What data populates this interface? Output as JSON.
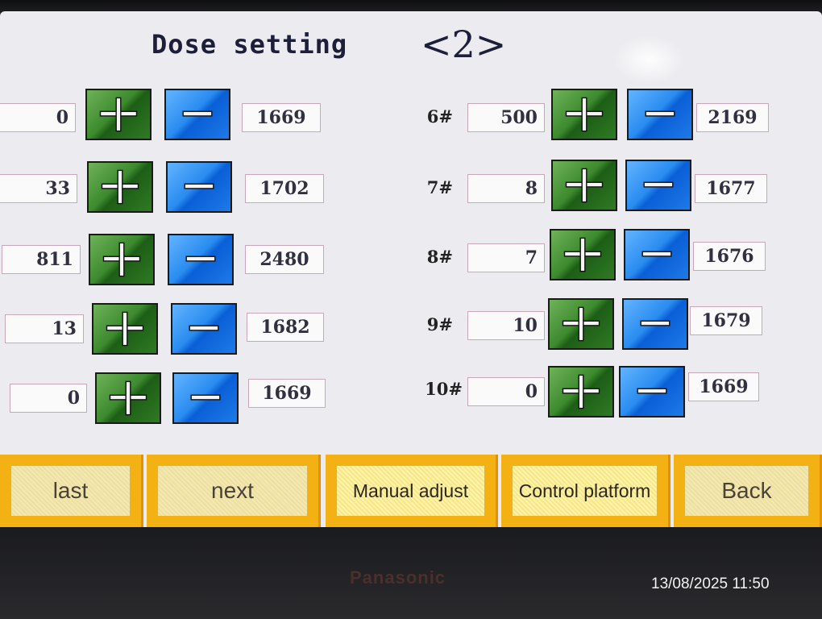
{
  "screen": {
    "title": "Dose setting",
    "page_indicator": "<2>"
  },
  "left_rows": [
    {
      "value": "0",
      "total": "1669"
    },
    {
      "value": "33",
      "total": "1702"
    },
    {
      "value": "811",
      "total": "2480"
    },
    {
      "value": "13",
      "total": "1682"
    },
    {
      "value": "0",
      "total": "1669"
    }
  ],
  "right_rows": [
    {
      "label": "6#",
      "value": "500",
      "total": "2169"
    },
    {
      "label": "7#",
      "value": "8",
      "total": "1677"
    },
    {
      "label": "8#",
      "value": "7",
      "total": "1676"
    },
    {
      "label": "9#",
      "value": "10",
      "total": "1679"
    },
    {
      "label": "10#",
      "value": "0",
      "total": "1669"
    }
  ],
  "bottom_nav": {
    "last": "last",
    "next": "next",
    "manual_adjust": "Manual adjust",
    "control_platform": "Control platform",
    "back": "Back"
  },
  "device": {
    "brand": "Panasonic",
    "photo_timestamp": "13/08/2025 11:50"
  },
  "icons": {
    "plus": "plus-icon",
    "minus": "minus-icon"
  },
  "colors": {
    "plus_button": "#3d8a2e",
    "minus_button": "#2a8cf0",
    "nav_button": "#f3b114",
    "screen_bg": "#ececf0"
  }
}
